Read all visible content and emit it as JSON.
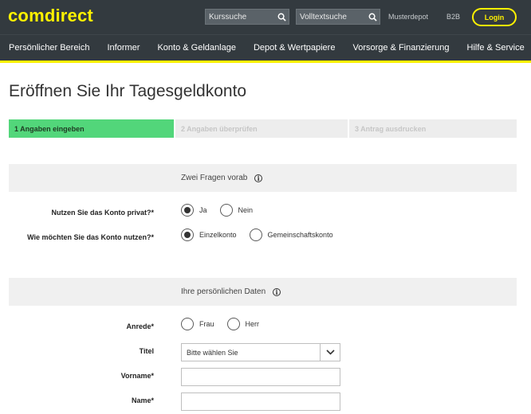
{
  "header": {
    "logo": "comdirect",
    "search1_placeholder": "Kurssuche",
    "search2_placeholder": "Volltextsuche",
    "link_musterdepot": "Musterdepot",
    "link_b2b": "B2B",
    "login_label": "Login"
  },
  "nav": {
    "items": [
      "Persönlicher Bereich",
      "Informer",
      "Konto & Geldanlage",
      "Depot & Wertpapiere",
      "Vorsorge & Finanzierung",
      "Hilfe & Service"
    ]
  },
  "page": {
    "title": "Eröffnen Sie Ihr Tagesgeldkonto",
    "steps": [
      "1 Angaben eingeben",
      "2 Angaben überprüfen",
      "3 Antrag ausdrucken"
    ]
  },
  "section1": {
    "title": "Zwei Fragen vorab",
    "q1_label": "Nutzen Sie das Konto privat?*",
    "q1_options": [
      "Ja",
      "Nein"
    ],
    "q2_label": "Wie möchten Sie das Konto nutzen?*",
    "q2_options": [
      "Einzelkonto",
      "Gemeinschaftskonto"
    ]
  },
  "section2": {
    "title": "Ihre persönlichen Daten",
    "anrede_label": "Anrede*",
    "anrede_options": [
      "Frau",
      "Herr"
    ],
    "titel_label": "Titel",
    "titel_value": "Bitte wählen Sie",
    "vorname_label": "Vorname*",
    "name_label": "Name*"
  },
  "colors": {
    "brand_yellow": "#fff200",
    "header_bg": "#333a3f",
    "step_active": "#52d67a"
  }
}
